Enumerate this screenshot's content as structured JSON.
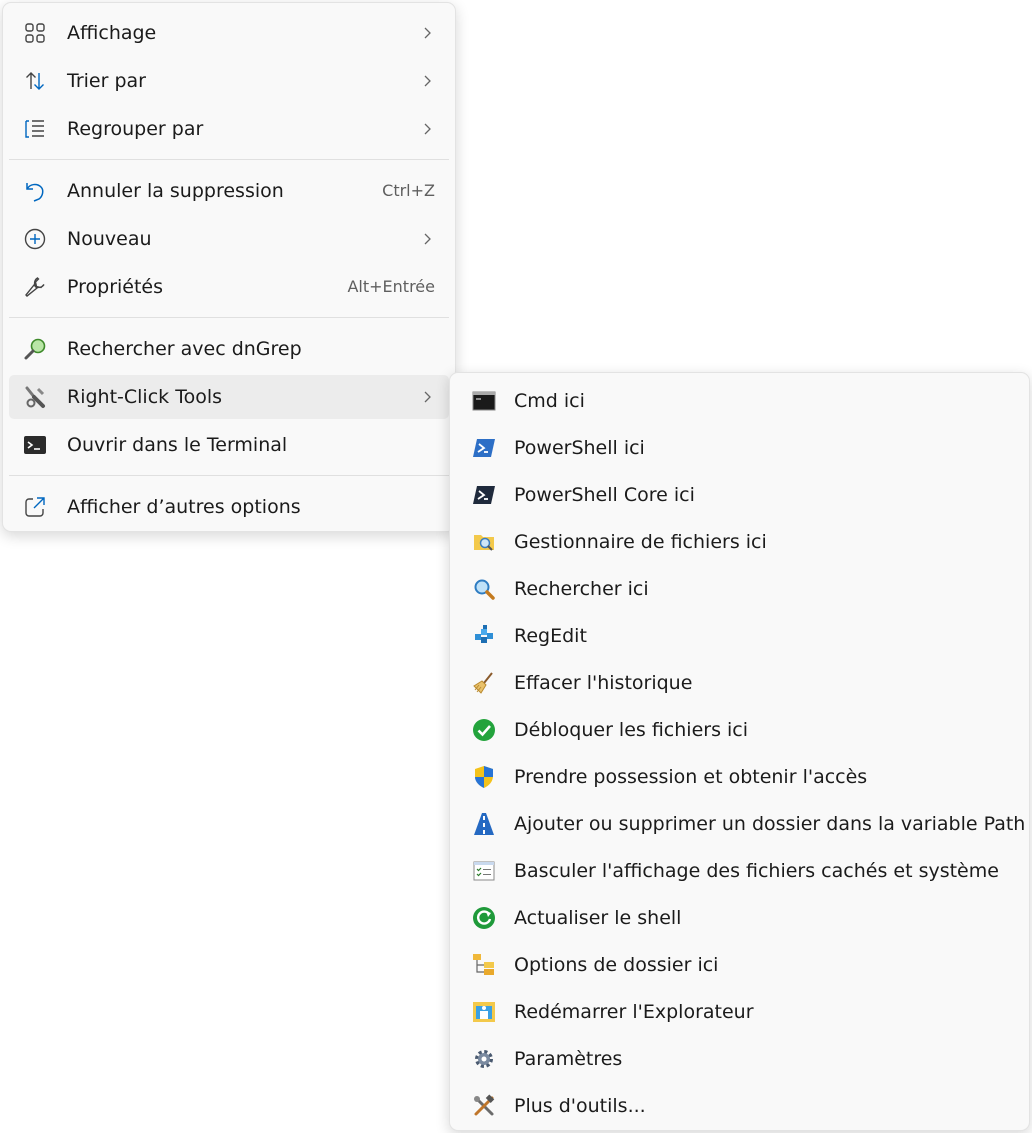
{
  "main_menu": {
    "items": [
      {
        "label": "Affichage",
        "icon": "view-grid-icon",
        "submenu": true
      },
      {
        "label": "Trier par",
        "icon": "sort-arrows-icon",
        "submenu": true
      },
      {
        "label": "Regrouper par",
        "icon": "group-list-icon",
        "submenu": true
      },
      {
        "label": "Annuler la suppression",
        "icon": "undo-icon",
        "shortcut": "Ctrl+Z"
      },
      {
        "label": "Nouveau",
        "icon": "new-plus-icon",
        "submenu": true
      },
      {
        "label": "Propriétés",
        "icon": "wrench-icon",
        "shortcut": "Alt+Entrée"
      },
      {
        "label": "Rechercher avec dnGrep",
        "icon": "dngrep-magnifier-icon"
      },
      {
        "label": "Right-Click Tools",
        "icon": "tools-icon",
        "submenu": true,
        "highlighted": true
      },
      {
        "label": "Ouvrir dans le Terminal",
        "icon": "terminal-icon"
      },
      {
        "label": "Afficher d’autres options",
        "icon": "share-external-icon"
      }
    ]
  },
  "sub_menu": {
    "items": [
      {
        "label": "Cmd ici",
        "icon": "cmd-icon"
      },
      {
        "label": "PowerShell ici",
        "icon": "powershell-icon"
      },
      {
        "label": "PowerShell Core ici",
        "icon": "powershell-core-icon"
      },
      {
        "label": "Gestionnaire de fichiers ici",
        "icon": "file-manager-icon"
      },
      {
        "label": "Rechercher ici",
        "icon": "search-icon"
      },
      {
        "label": "RegEdit",
        "icon": "regedit-icon"
      },
      {
        "label": "Effacer l'historique",
        "icon": "broom-icon"
      },
      {
        "label": "Débloquer les fichiers ici",
        "icon": "check-circle-icon"
      },
      {
        "label": "Prendre possession et obtenir l'accès",
        "icon": "uac-shield-icon"
      },
      {
        "label": "Ajouter ou supprimer un dossier dans la variable Path",
        "icon": "path-road-icon"
      },
      {
        "label": "Basculer l'affichage des fichiers cachés et système",
        "icon": "checklist-window-icon"
      },
      {
        "label": "Actualiser le shell",
        "icon": "refresh-icon"
      },
      {
        "label": "Options de dossier ici",
        "icon": "folder-options-icon"
      },
      {
        "label": "Redémarrer l'Explorateur",
        "icon": "restart-explorer-icon"
      },
      {
        "label": "Paramètres",
        "icon": "settings-gear-icon"
      },
      {
        "label": "Plus d'outils...",
        "icon": "more-tools-icon"
      }
    ]
  },
  "colors": {
    "menu_bg": "#f9f9f9",
    "hover_bg": "#ececec",
    "accent_blue": "#0067c0",
    "shortcut_text": "#5f5f5f"
  }
}
